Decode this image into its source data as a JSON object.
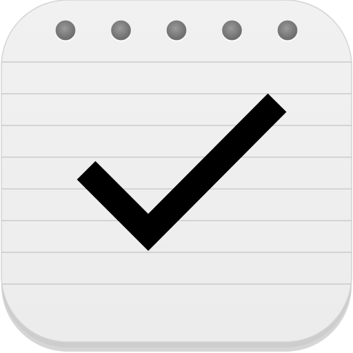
{
  "app_icon": {
    "icon": "notepad-checkmark-icon",
    "page_color": "#ececec",
    "edge_color": "#d6d6d6",
    "ruled_line_color": "#c4c4c4",
    "binding_hole_color": "#7d7d7d",
    "binding_hole_count": 5,
    "ruled_line_count": 8,
    "check_icon": "checkmark-icon",
    "check_color": "#000000"
  }
}
